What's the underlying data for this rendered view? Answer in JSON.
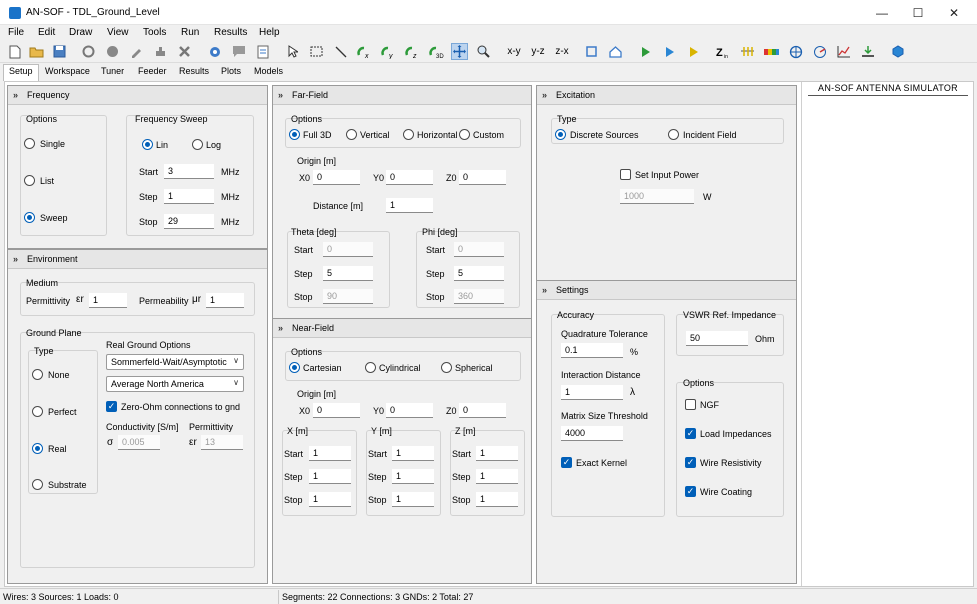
{
  "window": {
    "title": "AN-SOF - TDL_Ground_Level",
    "minimize": "—",
    "maximize": "☐",
    "close": "✕"
  },
  "menu": [
    "File",
    "Edit",
    "Draw",
    "View",
    "Tools",
    "Run",
    "Results",
    "Help"
  ],
  "toolbar": {
    "xy": "x-y",
    "yz": "y-z",
    "zx": "z-x"
  },
  "tabs": [
    "Setup",
    "Workspace",
    "Tuner",
    "Feeder",
    "Results",
    "Plots",
    "Models"
  ],
  "frequency": {
    "header": "Frequency",
    "options_label": "Options",
    "options": [
      "Single",
      "List",
      "Sweep"
    ],
    "selected": "Sweep",
    "sweep_label": "Frequency Sweep",
    "lin": "Lin",
    "log": "Log",
    "start_label": "Start",
    "start": "3",
    "step_label": "Step",
    "step": "1",
    "stop_label": "Stop",
    "stop": "29",
    "unit": "MHz"
  },
  "environment": {
    "header": "Environment",
    "medium_label": "Medium",
    "permittivity_label": "Permittivity",
    "permittivity_sym": "εr",
    "permittivity": "1",
    "permeability_label": "Permeability",
    "permeability_sym": "μr",
    "permeability": "1",
    "ground_plane_label": "Ground Plane",
    "type_label": "Type",
    "types": [
      "None",
      "Perfect",
      "Real",
      "Substrate"
    ],
    "selected_type": "Real",
    "real_ground_label": "Real Ground Options",
    "method": "Sommerfeld-Wait/Asymptotic",
    "soil": "Average North America",
    "zero_ohm_label": "Zero-Ohm connections to gnd",
    "conductivity_label": "Conductivity [S/m]",
    "conductivity_sym": "σ",
    "conductivity": "0.005",
    "gnd_permittivity_label": "Permittivity",
    "gnd_permittivity_sym": "εr",
    "gnd_permittivity": "13"
  },
  "farfield": {
    "header": "Far-Field",
    "options_label": "Options",
    "options": [
      "Full 3D",
      "Vertical",
      "Horizontal",
      "Custom"
    ],
    "origin_label": "Origin [m]",
    "x0_label": "X0",
    "x0": "0",
    "y0_label": "Y0",
    "y0": "0",
    "z0_label": "Z0",
    "z0": "0",
    "distance_label": "Distance [m]",
    "distance": "1",
    "theta_label": "Theta [deg]",
    "theta_start": "0",
    "theta_step": "5",
    "theta_stop": "90",
    "phi_label": "Phi [deg]",
    "phi_start": "0",
    "phi_step": "5",
    "phi_stop": "360",
    "start_label": "Start",
    "step_label": "Step",
    "stop_label": "Stop"
  },
  "nearfield": {
    "header": "Near-Field",
    "options_label": "Options",
    "options": [
      "Cartesian",
      "Cylindrical",
      "Spherical"
    ],
    "origin_label": "Origin [m]",
    "x0_label": "X0",
    "x0": "0",
    "y0_label": "Y0",
    "y0": "0",
    "z0_label": "Z0",
    "z0": "0",
    "x_label": "X [m]",
    "y_label": "Y [m]",
    "z_label": "Z [m]",
    "start_label": "Start",
    "step_label": "Step",
    "stop_label": "Stop",
    "x_start": "1",
    "x_step": "1",
    "x_stop": "1",
    "y_start": "1",
    "y_step": "1",
    "y_stop": "1",
    "z_start": "1",
    "z_step": "1",
    "z_stop": "1"
  },
  "excitation": {
    "header": "Excitation",
    "type_label": "Type",
    "types": [
      "Discrete Sources",
      "Incident Field"
    ],
    "set_power_label": "Set Input Power",
    "power": "1000",
    "power_unit": "W"
  },
  "settings": {
    "header": "Settings",
    "accuracy_label": "Accuracy",
    "quad_tol_label": "Quadrature Tolerance",
    "quad_tol": "0.1",
    "quad_unit": "%",
    "interaction_label": "Interaction Distance",
    "interaction": "1",
    "interaction_unit": "λ",
    "matrix_label": "Matrix Size Threshold",
    "matrix": "4000",
    "exact_kernel_label": "Exact Kernel",
    "vswr_label": "VSWR Ref. Impedance",
    "vswr": "50",
    "vswr_unit": "Ohm",
    "options_label": "Options",
    "ngf_label": "NGF",
    "load_imp_label": "Load Impedances",
    "wire_res_label": "Wire Resistivity",
    "wire_coat_label": "Wire Coating"
  },
  "simulator_label": "AN-SOF ANTENNA SIMULATOR",
  "status": {
    "left": "Wires: 3  Sources: 1  Loads: 0",
    "right": "Segments: 22  Connections: 3  GNDs: 2  Total: 27"
  }
}
